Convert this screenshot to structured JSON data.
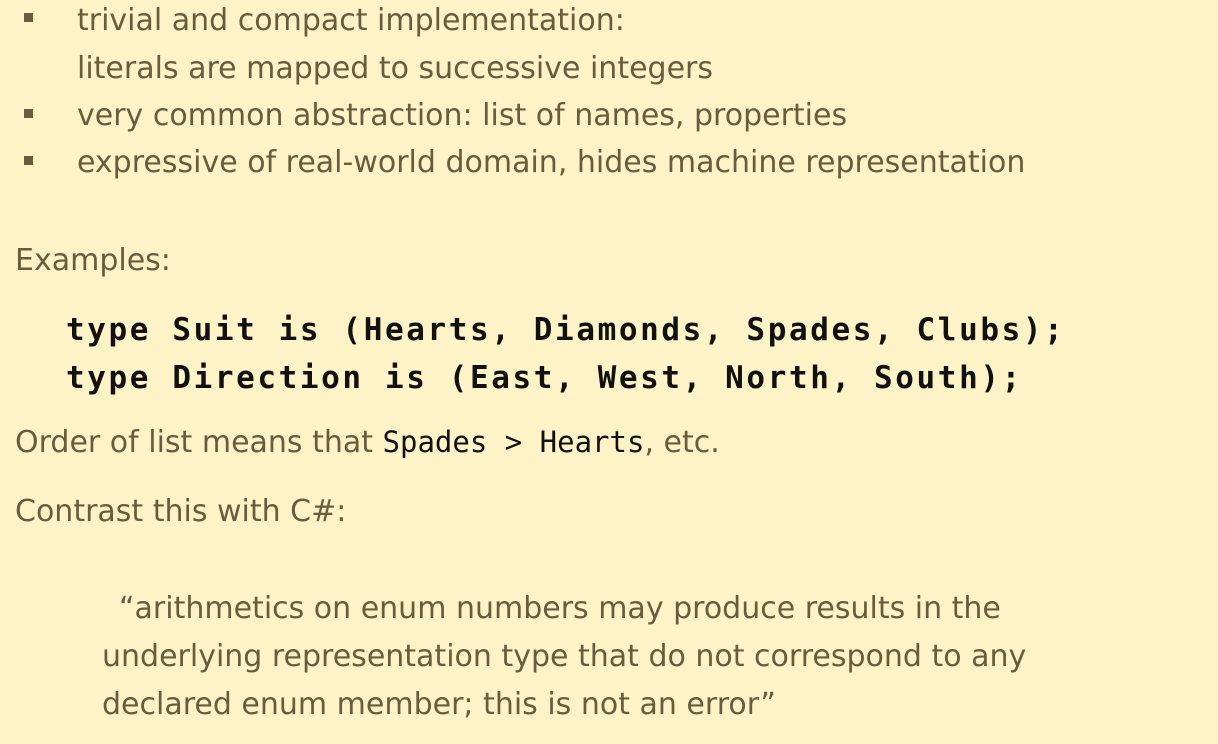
{
  "bullets": [
    {
      "lines": [
        "trivial and compact implementation:",
        "literals are mapped to successive integers"
      ]
    },
    {
      "lines": [
        "very common abstraction: list of names, properties"
      ]
    },
    {
      "lines": [
        "expressive of real-world domain, hides machine representation"
      ]
    }
  ],
  "examples_label": "Examples:",
  "code_lines": [
    "type Suit is (Hearts, Diamonds, Spades, Clubs);",
    "type Direction is (East, West, North, South);"
  ],
  "order_sentence": {
    "prefix": "Order of list means that ",
    "code": "Spades > Hearts",
    "suffix": ", etc."
  },
  "contrast_label": "Contrast this with C#:",
  "quote_lines": [
    "“arithmetics on enum numbers may produce results in the",
    "underlying representation type that do not correspond to any",
    "declared enum member; this is not an error”"
  ]
}
